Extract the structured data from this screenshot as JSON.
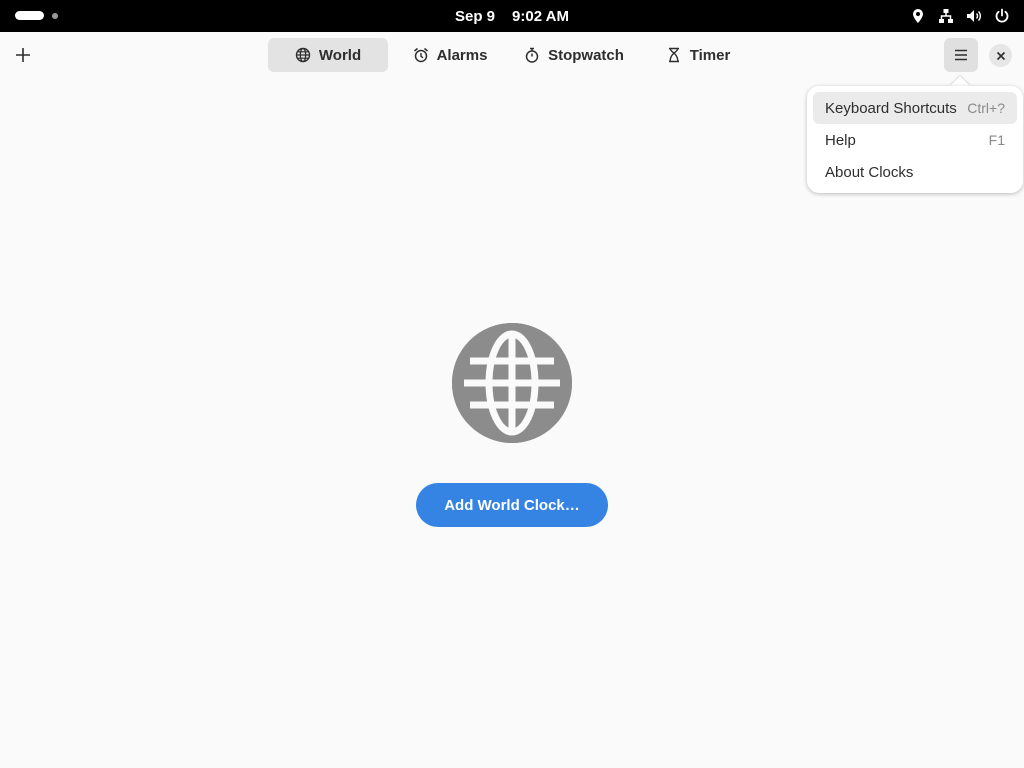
{
  "topbar": {
    "date": "Sep 9",
    "time": "9:02 AM",
    "icons": [
      "location-icon",
      "network-icon",
      "volume-icon",
      "power-icon"
    ]
  },
  "header": {
    "tabs": [
      {
        "label": "World",
        "icon": "globe-icon",
        "active": true
      },
      {
        "label": "Alarms",
        "icon": "alarm-icon",
        "active": false
      },
      {
        "label": "Stopwatch",
        "icon": "stopwatch-icon",
        "active": false
      },
      {
        "label": "Timer",
        "icon": "hourglass-icon",
        "active": false
      }
    ]
  },
  "main": {
    "add_world_clock_label": "Add World Clock…"
  },
  "menu": {
    "items": [
      {
        "label": "Keyboard Shortcuts",
        "accel": "Ctrl+?"
      },
      {
        "label": "Help",
        "accel": "F1"
      },
      {
        "label": "About Clocks",
        "accel": ""
      }
    ]
  },
  "colors": {
    "accent": "#3584e4",
    "topbar": "#000000",
    "background": "#fafafa"
  }
}
